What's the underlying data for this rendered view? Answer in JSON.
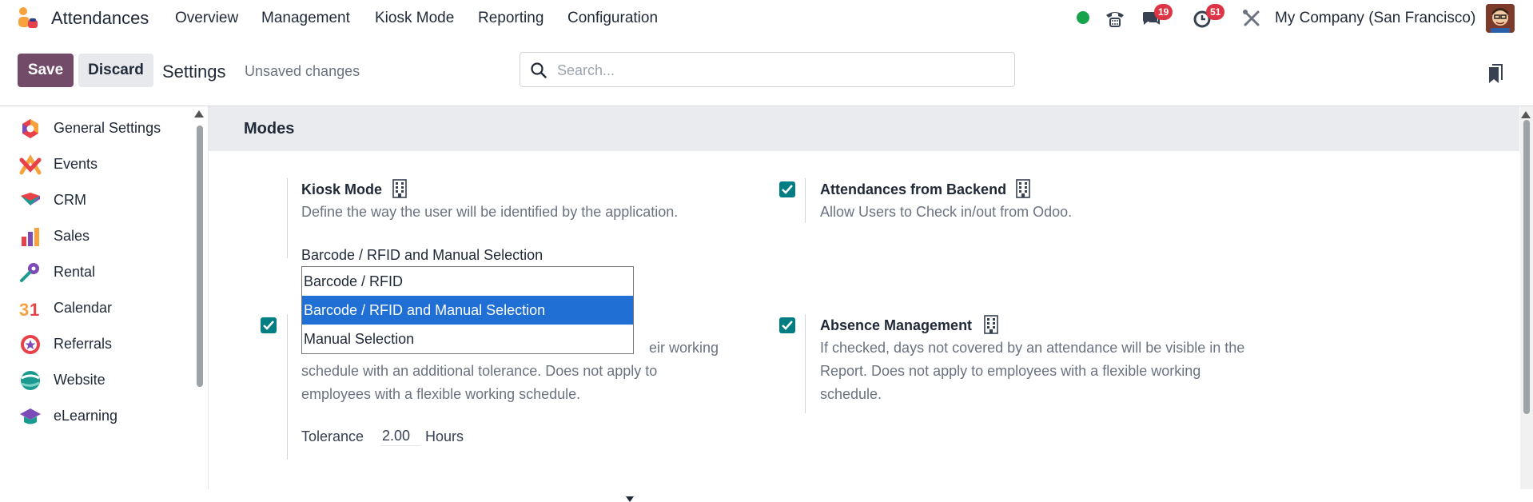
{
  "app": {
    "name": "Attendances"
  },
  "topnav": [
    "Overview",
    "Management",
    "Kiosk Mode",
    "Reporting",
    "Configuration"
  ],
  "systray": {
    "messages_badge": "19",
    "activities_badge": "51",
    "company": "My Company (San Francisco)"
  },
  "control": {
    "save": "Save",
    "discard": "Discard",
    "title": "Settings",
    "unsaved": "Unsaved changes",
    "search_placeholder": "Search..."
  },
  "sidebar": {
    "items": [
      {
        "label": "General Settings",
        "icon": "general-settings-icon"
      },
      {
        "label": "Events",
        "icon": "events-icon"
      },
      {
        "label": "CRM",
        "icon": "crm-icon"
      },
      {
        "label": "Sales",
        "icon": "sales-icon"
      },
      {
        "label": "Rental",
        "icon": "rental-icon"
      },
      {
        "label": "Calendar",
        "icon": "calendar-icon"
      },
      {
        "label": "Referrals",
        "icon": "referrals-icon"
      },
      {
        "label": "Website",
        "icon": "website-icon"
      },
      {
        "label": "eLearning",
        "icon": "elearning-icon"
      }
    ]
  },
  "section": {
    "title": "Modes"
  },
  "settings": {
    "kiosk": {
      "title": "Kiosk Mode",
      "desc": "Define the way the user will be identified by the application.",
      "selected": "Barcode / RFID and Manual Selection",
      "options": [
        "Barcode / RFID",
        "Barcode / RFID and Manual Selection",
        "Manual Selection"
      ]
    },
    "backend": {
      "title": "Attendances from Backend",
      "desc": "Allow Users to Check in/out from Odoo.",
      "checked": true
    },
    "extra": {
      "desc_partial": "eir working",
      "desc_rest": "schedule with an additional tolerance. Does not apply to employees with a flexible working schedule.",
      "checked": true,
      "tolerance_label": "Tolerance",
      "tolerance_value": "2.00",
      "tolerance_unit": "Hours"
    },
    "absence": {
      "title": "Absence Management",
      "desc": "If checked, days not covered by an attendance will be visible in the Report. Does not apply to employees with a flexible working schedule.",
      "checked": true
    }
  },
  "colors": {
    "brand": "#714b67",
    "checkbox": "#017e84",
    "selected_option": "#1f6fd4",
    "badge": "#dc3545"
  }
}
